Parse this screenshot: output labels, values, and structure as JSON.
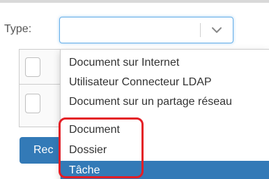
{
  "form": {
    "type_label": "Type:",
    "type_value": "",
    "button_label": "Rec"
  },
  "dropdown": {
    "options": [
      {
        "label": "Document sur Internet",
        "selected": false
      },
      {
        "label": "Utilisateur Connecteur LDAP",
        "selected": false
      },
      {
        "label": "Document sur un partage réseau",
        "selected": false
      },
      {
        "label": "Document",
        "selected": false
      },
      {
        "label": "Dossier",
        "selected": false
      },
      {
        "label": "Tâche",
        "selected": true
      }
    ]
  },
  "icons": {
    "select_arrow": "chevron-down-icon",
    "checkbox": "checkbox-icon"
  },
  "colors": {
    "accent": "#337ab7",
    "focus_border": "#66afe9",
    "annotation": "#e41e26"
  }
}
